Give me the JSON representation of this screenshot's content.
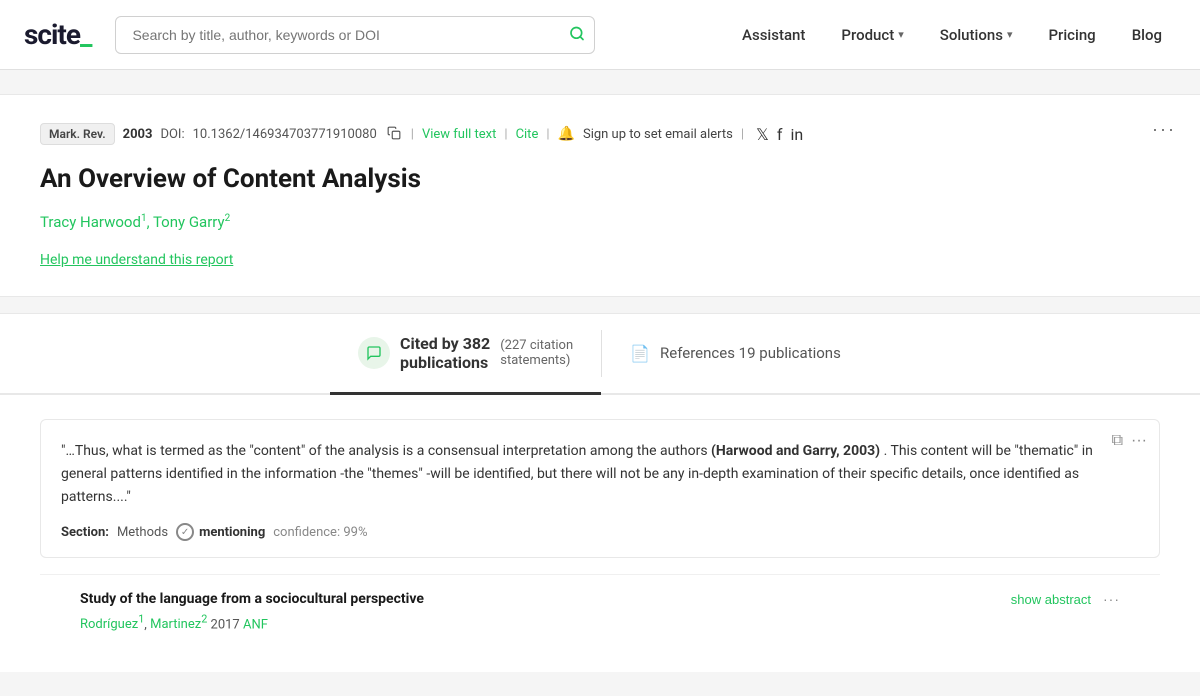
{
  "header": {
    "logo": "scite_",
    "logo_accent": "_",
    "search_placeholder": "Search by title, author, keywords or DOI",
    "nav": [
      {
        "label": "Assistant",
        "has_dropdown": false
      },
      {
        "label": "Product",
        "has_dropdown": true
      },
      {
        "label": "Solutions",
        "has_dropdown": true
      },
      {
        "label": "Pricing",
        "has_dropdown": false
      },
      {
        "label": "Blog",
        "has_dropdown": false
      }
    ]
  },
  "paper": {
    "journal": "Mark. Rev.",
    "year": "2003",
    "doi_label": "DOI:",
    "doi": "10.1362/146934703771910080",
    "view_full_text": "View full text",
    "cite": "Cite",
    "alert_text": "Sign up to set email alerts",
    "title": "An Overview of Content Analysis",
    "authors": [
      {
        "name": "Tracy Harwood",
        "sup": "1"
      },
      {
        "name": "Tony Garry",
        "sup": "2"
      }
    ],
    "help_link": "Help me understand this report",
    "more_dots": "···"
  },
  "tabs": {
    "cited_by_main": "Cited by 382",
    "cited_by_sub": "publications",
    "citation_statements": "(227 citation",
    "citation_statements2": "statements)",
    "references_label": "References 19 publications"
  },
  "citation_card": {
    "text_start": "\"…Thus, what is termed as the \"content\" of the analysis is a consensual interpretation among the authors",
    "text_bold": "(Harwood and Garry, 2003)",
    "text_end": ". This content will be \"thematic\" in general patterns identified in the information -the \"themes\" -will be identified, but there will not be any in-depth examination of their specific details, once identified as patterns....\"",
    "section_label": "Section:",
    "section_value": "Methods",
    "mentioning_label": "mentioning",
    "confidence_label": "confidence: 99%",
    "copy_icon": "⧉",
    "more_dots": "···"
  },
  "citing_paper": {
    "title": "Study of the language from a sociocultural perspective",
    "authors": [
      "Rodríguez",
      "Martinez"
    ],
    "sups": [
      "1",
      "2"
    ],
    "year": "2017",
    "journal": "ANF",
    "show_abstract": "show abstract",
    "more_dots": "···"
  }
}
